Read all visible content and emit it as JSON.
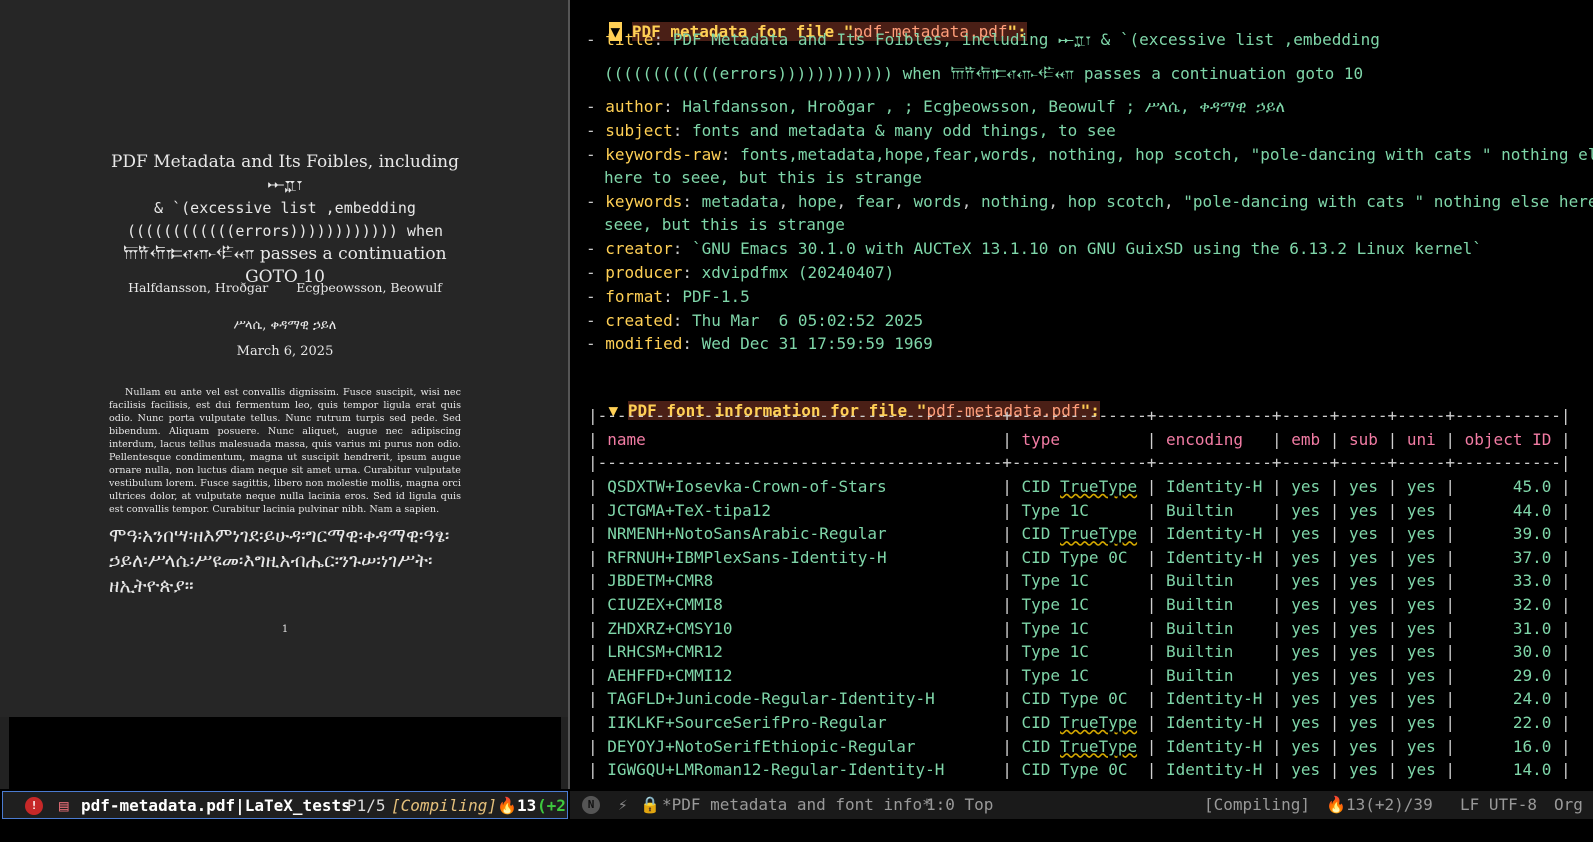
{
  "pdf_view": {
    "title_line1": "PDF Metadata and Its Foibles, including 𐎀𐎁𐎂",
    "title_line2": "& `(excessive list ,embedding",
    "title_line3": "((((((((((((errors)))))))))))) when",
    "title_line4_glyphs": "𐎠𐎡𐎢𐎣𐎤𐎥𐎦𐎧",
    "title_line4_text": "passes a continuation",
    "title_line5": "GOTO 10",
    "author1": "Halfdansson, Hroðgar",
    "author2": "Ecgþeowsson, Beowulf",
    "author3": "ሥላሴ, ቀዳማዊ ኃይለ",
    "date": "March 6, 2025",
    "paragraph": "Nullam eu ante vel est convallis dignissim. Fusce suscipit, wisi nec facilisis facilisis, est dui fermentum leo, quis tempor ligula erat quis odio. Nunc porta vulputate tellus. Nunc rutrum turpis sed pede. Sed bibendum. Aliquam posuere. Nunc aliquet, augue nec adipiscing interdum, lacus tellus malesuada massa, quis varius mi purus non odio. Pellentesque condimentum, magna ut suscipit hendrerit, ipsum augue ornare nulla, non luctus diam neque sit amet urna. Curabitur vulputate vestibulum lorem. Fusce sagittis, libero non molestie mollis, magna orci ultrices dolor, at vulputate neque nulla lacinia eros. Sed id ligula quis est convallis tempor. Curabitur lacinia pulvinar nibh. Nam a sapien.",
    "ethiopic_paragraph": "ሞዓ፡አንበሣ፡ዘእምነገደ፡ይሁዳ፡ግርማዊ፡ቀዳማዊ፡ዓፄ፡ኃይለ፡ሥላሴ፡ሥዩመ፡እግዚአብሔር፡ንጉሠ፡ነገሥት፡ዘኢትዮጵያ።",
    "page_number": "1"
  },
  "metadata": {
    "heading_prefix": "PDF metadata for file \"",
    "heading_file": "pdf-metadata.pdf",
    "heading_suffix": "\":",
    "title_key": "title",
    "title_val1": "PDF Metadata and Its Foibles, including 𐎀𐎁𐎂 & `(excessive list ,embedding",
    "title_val2a": "((((((((((((errors)))))))))))) when",
    "title_val2b": "𐎠𐎡𐎢𐎣𐎤𐎥𐎦𐎧",
    "title_val2c": "passes a continuation goto 10",
    "author_key": "author",
    "author_val": "Halfdansson, Hroðgar , ; Ecgþeowsson, Beowulf ; ሥላሴ, ቀዳማዊ ኃይለ",
    "subject_key": "subject",
    "subject_val": "fonts and metadata & many odd things, to see",
    "kwraw_key": "keywords-raw",
    "kwraw_val1": "fonts,metadata,hope,fear,words, nothing, hop scotch, \"pole-dancing with cats \" nothing else",
    "kwraw_val2": "here to seee, but this is strange",
    "kw_key": "keywords",
    "kw_items": [
      "metadata",
      "hope",
      "fear",
      "words",
      "nothing",
      "hop scotch",
      "\"pole-dancing with cats \" nothing else here to"
    ],
    "kw_val2": "seee, but this is strange",
    "creator_key": "creator",
    "creator_val": "`GNU Emacs 30.1.0 with AUCTeX 13.1.10 on GNU GuixSD using the 6.13.2 Linux kernel`",
    "producer_key": "producer",
    "producer_val": "xdvipdfmx (20240407)",
    "format_key": "format",
    "format_val": "PDF-1.5",
    "created_key": "created",
    "created_val": "Thu Mar  6 05:02:52 2025",
    "modified_key": "modified",
    "modified_val": "Wed Dec 31 17:59:59 1969"
  },
  "fonts": {
    "heading_prefix": "PDF font information for file \"",
    "heading_file": "pdf-metadata.pdf",
    "heading_suffix": "\":",
    "columns": [
      "name",
      "type",
      "encoding",
      "emb",
      "sub",
      "uni",
      "object ID"
    ],
    "rows": [
      [
        "QSDXTW+Iosevka-Crown-of-Stars",
        "CID TrueType",
        "Identity-H",
        "yes",
        "yes",
        "yes",
        "45.0"
      ],
      [
        "JCTGMA+TeX-tipa12",
        "Type 1C",
        "Builtin",
        "yes",
        "yes",
        "yes",
        "44.0"
      ],
      [
        "NRMENH+NotoSansArabic-Regular",
        "CID TrueType",
        "Identity-H",
        "yes",
        "yes",
        "yes",
        "39.0"
      ],
      [
        "RFRNUH+IBMPlexSans-Identity-H",
        "CID Type 0C",
        "Identity-H",
        "yes",
        "yes",
        "yes",
        "37.0"
      ],
      [
        "JBDETM+CMR8",
        "Type 1C",
        "Builtin",
        "yes",
        "yes",
        "yes",
        "33.0"
      ],
      [
        "CIUZEX+CMMI8",
        "Type 1C",
        "Builtin",
        "yes",
        "yes",
        "yes",
        "32.0"
      ],
      [
        "ZHDXRZ+CMSY10",
        "Type 1C",
        "Builtin",
        "yes",
        "yes",
        "yes",
        "31.0"
      ],
      [
        "LRHCSM+CMR12",
        "Type 1C",
        "Builtin",
        "yes",
        "yes",
        "yes",
        "30.0"
      ],
      [
        "AEHFFD+CMMI12",
        "Type 1C",
        "Builtin",
        "yes",
        "yes",
        "yes",
        "29.0"
      ],
      [
        "TAGFLD+Junicode-Regular-Identity-H",
        "CID Type 0C",
        "Identity-H",
        "yes",
        "yes",
        "yes",
        "24.0"
      ],
      [
        "IIKLKF+SourceSerifPro-Regular",
        "CID TrueType",
        "Identity-H",
        "yes",
        "yes",
        "yes",
        "22.0"
      ],
      [
        "DEYOYJ+NotoSerifEthiopic-Regular",
        "CID TrueType",
        "Identity-H",
        "yes",
        "yes",
        "yes",
        "16.0"
      ],
      [
        "IGWGQU+LMRoman12-Regular-Identity-H",
        "CID Type 0C",
        "Identity-H",
        "yes",
        "yes",
        "yes",
        "14.0"
      ]
    ]
  },
  "modeline_left": {
    "error_badge": "!",
    "buffer": "pdf-metadata.pdf|LaTeX_tests",
    "page": "P1/5",
    "status": "[Compiling]",
    "count": "13",
    "count_extra": "(+2"
  },
  "modeline_right": {
    "badge": "N",
    "buffer": "*PDF metadata and font info*",
    "position": "1:0 Top",
    "status": "[Compiling]",
    "count": "13(+2)/39",
    "encoding": "LF UTF-8",
    "mode": "Org"
  },
  "colors": {
    "heading_bg": "#4a1f16",
    "key": "#ffd055",
    "value": "#7fd6a9",
    "table_header": "#f27ca4",
    "active_border": "#4b7bd1"
  }
}
